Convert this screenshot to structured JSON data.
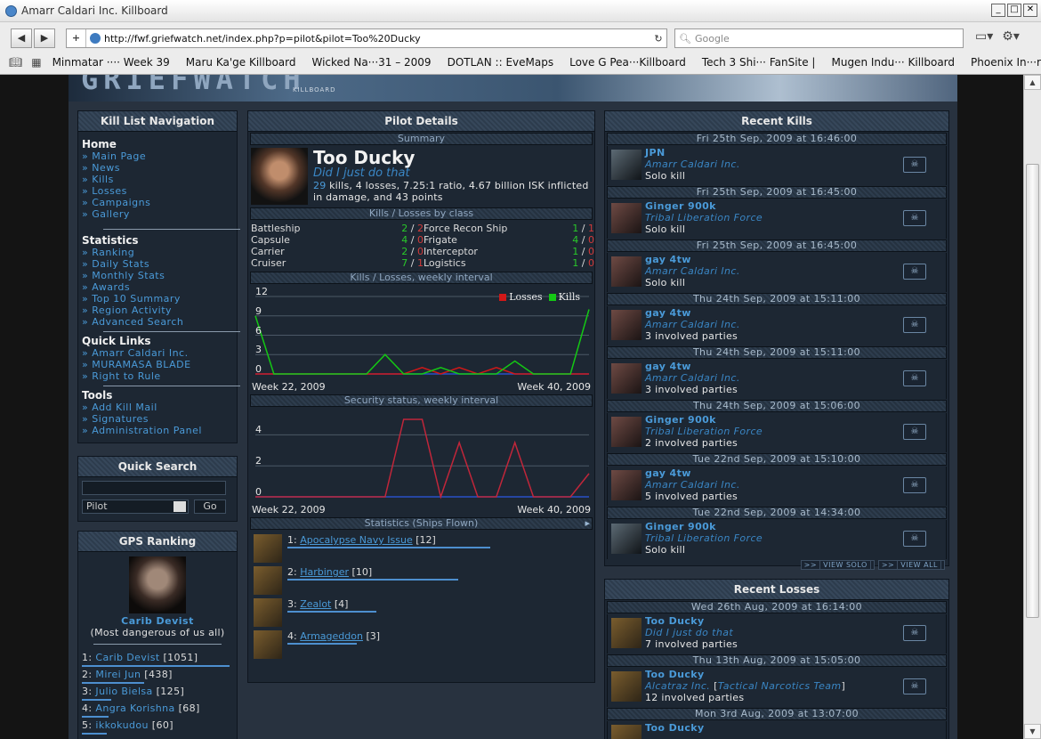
{
  "browser": {
    "window_title": "Amarr Caldari Inc. Killboard",
    "url": "http://fwf.griefwatch.net/index.php?p=pilot&pilot=Too%20Ducky",
    "search_placeholder": "Google",
    "bookmarks": [
      "Minmatar ···· Week 39",
      "Maru Ka'ge Killboard",
      "Wicked Na···31 – 2009",
      "DOTLAN :: EveMaps",
      "Love G Pea···Killboard",
      "Tech 3 Shi··· FanSite |",
      "Mugen Indu··· Killboard",
      "Phoenix In···ries: News"
    ]
  },
  "site": {
    "logo_sub": "KILLBOARD"
  },
  "nav": {
    "title": "Kill List Navigation",
    "home_heading": "Home",
    "home_links": [
      "Main Page",
      "News",
      "Kills",
      "Losses",
      "Campaigns",
      "Gallery"
    ],
    "stats_heading": "Statistics",
    "stats_links": [
      "Ranking",
      "Daily Stats",
      "Monthly Stats",
      "Awards",
      "Top 10 Summary",
      "Region Activity",
      "Advanced Search"
    ],
    "quick_heading": "Quick Links",
    "quick_links": [
      "Amarr Caldari Inc.",
      "MURAMASA BLADE",
      "Right to Rule"
    ],
    "tools_heading": "Tools",
    "tools_links": [
      "Add Kill Mail",
      "Signatures",
      "Administration Panel"
    ]
  },
  "quick_search": {
    "title": "Quick Search",
    "select_value": "Pilot",
    "go_label": "Go"
  },
  "gps": {
    "title": "GPS Ranking",
    "top_name": "Carib Devist",
    "top_sub": "(Most dangerous of us all)",
    "rows": [
      {
        "rank": "1:",
        "name": "Carib Devist",
        "score": "[1051]",
        "pct": 1.0
      },
      {
        "rank": "2:",
        "name": "Mirei Jun",
        "score": "[438]",
        "pct": 0.42
      },
      {
        "rank": "3:",
        "name": "Julio Bielsa",
        "score": "[125]",
        "pct": 0.2
      },
      {
        "rank": "4:",
        "name": "Angra Korishna",
        "score": "[68]",
        "pct": 0.18
      },
      {
        "rank": "5:",
        "name": "ikkokudou",
        "score": "[60]",
        "pct": 0.17
      }
    ]
  },
  "pilot": {
    "title": "Pilot Details",
    "summary_label": "Summary",
    "name": "Too Ducky",
    "tagline": "Did I just do that",
    "kills": "29",
    "losses": "4",
    "stats_rest": " kills, 4 losses, 7.25:1 ratio, 4.67 billion ISK inflicted in damage, and 43 points",
    "class_label": "Kills / Losses by class",
    "classes": [
      {
        "name": "Battleship",
        "k": "2",
        "l": "2"
      },
      {
        "name": "Force Recon Ship",
        "k": "1",
        "l": "1"
      },
      {
        "name": "Capsule",
        "k": "4",
        "l": "0"
      },
      {
        "name": "Frigate",
        "k": "4",
        "l": "0"
      },
      {
        "name": "Carrier",
        "k": "2",
        "l": "0"
      },
      {
        "name": "Interceptor",
        "k": "1",
        "l": "0"
      },
      {
        "name": "Cruiser",
        "k": "7",
        "l": "1"
      },
      {
        "name": "Logistics",
        "k": "1",
        "l": "0"
      }
    ],
    "weekly_label": "Kills / Losses, weekly interval",
    "security_label": "Security status, weekly interval",
    "ships_label": "Statistics (Ships Flown)",
    "ships": [
      {
        "rank": "1:",
        "name": "Apocalypse Navy Issue",
        "count": "[12]",
        "pct": 1.0
      },
      {
        "rank": "2:",
        "name": "Harbinger",
        "count": "[10]",
        "pct": 0.84
      },
      {
        "rank": "3:",
        "name": "Zealot",
        "count": "[4]",
        "pct": 0.44
      },
      {
        "rank": "4:",
        "name": "Armageddon",
        "count": "[3]",
        "pct": 0.34
      }
    ]
  },
  "chart_data": [
    {
      "type": "line",
      "title": "Kills / Losses, weekly interval",
      "x_start": "Week 22, 2009",
      "x_end": "Week 40, 2009",
      "yticks": [
        "12",
        "9",
        "6",
        "3",
        "0"
      ],
      "ylim": [
        0,
        12
      ],
      "x": [
        22,
        23,
        24,
        25,
        26,
        27,
        28,
        29,
        30,
        31,
        32,
        33,
        34,
        35,
        36,
        37,
        38,
        39,
        40
      ],
      "series": [
        {
          "name": "Losses",
          "color": "#d01818",
          "values": [
            0,
            0,
            0,
            0,
            0,
            0,
            0,
            0,
            0,
            1,
            0,
            1,
            0,
            1,
            0,
            0,
            0,
            0,
            0
          ]
        },
        {
          "name": "Kills",
          "color": "#14c814",
          "values": [
            9,
            0,
            0,
            0,
            0,
            0,
            0,
            3,
            0,
            0,
            1,
            0,
            0,
            0,
            2,
            0,
            0,
            0,
            10
          ]
        }
      ]
    },
    {
      "type": "line",
      "title": "Security status, weekly interval",
      "x_start": "Week 22, 2009",
      "x_end": "Week 40, 2009",
      "yticks": [
        "4",
        "2",
        "0"
      ],
      "ylim": [
        0,
        5
      ],
      "x": [
        22,
        23,
        24,
        25,
        26,
        27,
        28,
        29,
        30,
        31,
        32,
        33,
        34,
        35,
        36,
        37,
        38,
        39,
        40
      ],
      "series": [
        {
          "color": "#c0263a",
          "values": [
            0,
            0,
            0,
            0,
            0,
            0,
            0,
            0,
            5,
            5,
            0,
            3.5,
            0,
            0,
            3.5,
            0,
            0,
            0,
            1.5
          ]
        }
      ]
    }
  ],
  "recent_kills": {
    "title": "Recent Kills",
    "items": [
      {
        "date": "Fri 25th Sep, 2009 at 16:46:00",
        "name": "JPN",
        "corp": "Amarr Caldari Inc.",
        "detail": "Solo kill",
        "alt": true
      },
      {
        "date": "Fri 25th Sep, 2009 at 16:45:00",
        "name": "Ginger 900k",
        "corp": "Tribal Liberation Force",
        "detail": "Solo kill",
        "alt": false
      },
      {
        "date": "Fri 25th Sep, 2009 at 16:45:00",
        "name": "gay 4tw",
        "corp": "Amarr Caldari Inc.",
        "detail": "Solo kill",
        "alt": false
      },
      {
        "date": "Thu 24th Sep, 2009 at 15:11:00",
        "name": "gay 4tw",
        "corp": "Amarr Caldari Inc.",
        "detail": "3 involved parties",
        "alt": false
      },
      {
        "date": "Thu 24th Sep, 2009 at 15:11:00",
        "name": "gay 4tw",
        "corp": "Amarr Caldari Inc.",
        "detail": "3 involved parties",
        "alt": false
      },
      {
        "date": "Thu 24th Sep, 2009 at 15:06:00",
        "name": "Ginger 900k",
        "corp": "Tribal Liberation Force",
        "detail": "2 involved parties",
        "alt": false
      },
      {
        "date": "Tue 22nd Sep, 2009 at 15:10:00",
        "name": "gay 4tw",
        "corp": "Amarr Caldari Inc.",
        "detail": "5 involved parties",
        "alt": false
      },
      {
        "date": "Tue 22nd Sep, 2009 at 14:34:00",
        "name": "Ginger 900k",
        "corp": "Tribal Liberation Force",
        "detail": "Solo kill",
        "alt": true
      }
    ],
    "view_solo": "VIEW SOLO",
    "view_all": "VIEW ALL"
  },
  "recent_losses": {
    "title": "Recent Losses",
    "items": [
      {
        "date": "Wed 26th Aug, 2009 at 16:14:00",
        "name": "Too Ducky",
        "corp": "Did I just do that",
        "detail": "7 involved parties"
      },
      {
        "date": "Thu 13th Aug, 2009 at 15:05:00",
        "name": "Too Ducky",
        "corp": "Alcatraz Inc.",
        "alliance": "Tactical Narcotics Team",
        "detail": "12 involved parties"
      },
      {
        "date": "Mon 3rd Aug, 2009 at 13:07:00",
        "name": "Too Ducky",
        "corp": "",
        "detail": ""
      }
    ]
  }
}
